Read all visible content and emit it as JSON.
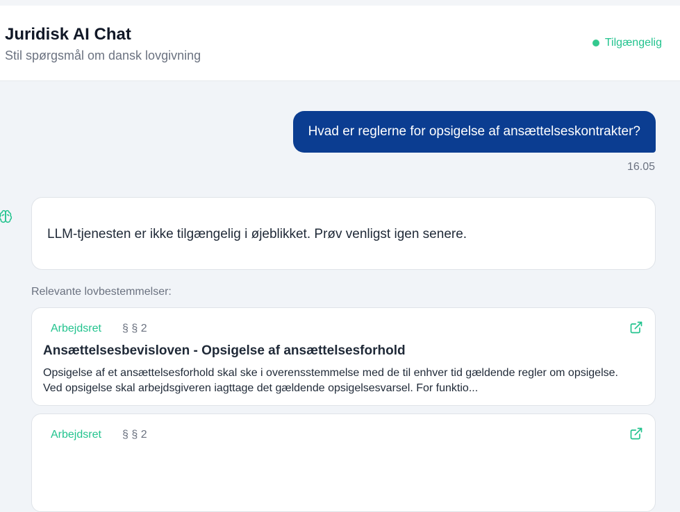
{
  "header": {
    "title": "Juridisk AI Chat",
    "subtitle": "Stil spørgsmål om dansk lovgivning",
    "status": "Tilgængelig"
  },
  "conversation": {
    "user_message": "Hvad er reglerne for opsigelse af ansættelseskontrakter?",
    "user_time": "16.05",
    "bot_icon": "brain-icon",
    "bot_message": "LLM-tjenesten er ikke tilgængelig i øjeblikket. Prøv venligst igen senere."
  },
  "relevant": {
    "label": "Relevante lovbestemmelser:",
    "cards": [
      {
        "tag": "Arbejdsret",
        "section": "§ § 2",
        "title": "Ansættelsesbevisloven - Opsigelse af ansættelsesforhold",
        "excerpt": "Opsigelse af et ansættelsesforhold skal ske i overensstemmelse med de til enhver tid gældende regler om opsigelse. Ved opsigelse skal arbejdsgiveren iagttage det gældende opsigelsesvarsel. For funktio...",
        "link_icon": "external-link-icon"
      },
      {
        "tag": "Arbejdsret",
        "section": "§ § 2",
        "link_icon": "external-link-icon"
      }
    ]
  },
  "colors": {
    "primary": "#0b3d91",
    "accent_green": "#22c38e",
    "muted": "#6b7280",
    "background": "#f1f4f8"
  }
}
